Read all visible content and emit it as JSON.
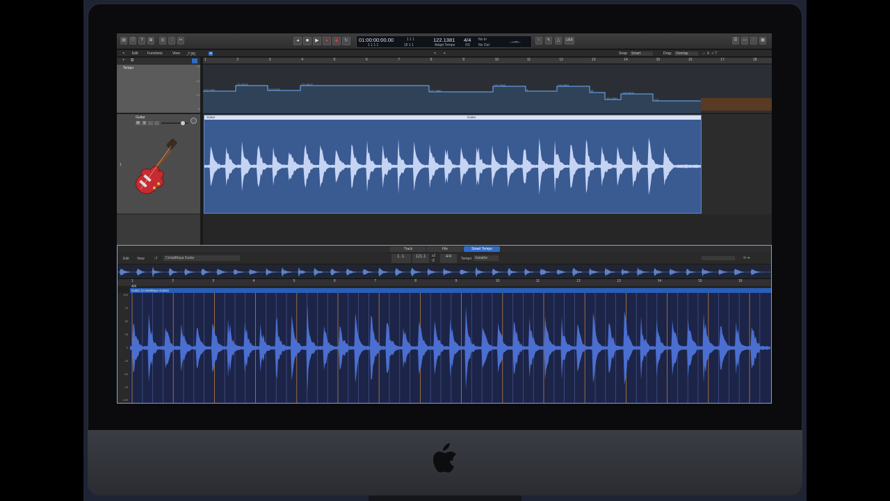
{
  "control_bar": {
    "lcd": {
      "position_time": "01:00:00:00.00",
      "position_bars": "1  1  1     1",
      "end_top": "1  1  1",
      "end_bottom": "16  1  1",
      "tempo": "122.1381",
      "tempo_mode": "Adapt Tempo",
      "signature": "4/4",
      "division": "/16",
      "midi_in": "No In",
      "midi_out": "No Out"
    },
    "cpu_badge": "c64"
  },
  "tracks_menubar": {
    "edit": "Edit",
    "functions": "Functions",
    "view": "View",
    "snap_label": "Snap:",
    "snap_value": "Smart",
    "drag_label": "Drag:",
    "drag_value": "Overlap"
  },
  "ruler_bars": [
    "1",
    "2",
    "3",
    "4",
    "5",
    "6",
    "7",
    "8",
    "9",
    "10",
    "11",
    "12",
    "13",
    "14",
    "15",
    "16",
    "17",
    "18"
  ],
  "tempo_track": {
    "name": "Tempo",
    "scale": [
      "130",
      "120",
      "110",
      "90"
    ],
    "values": [
      "122.1381",
      "120.8978",
      "123.5230",
      "121.8632",
      "121.7680",
      "120.1508",
      "5",
      "120.4081",
      "15",
      "111.3281",
      "109.9478",
      "110"
    ]
  },
  "guitar_track": {
    "number": "1",
    "name": "Guitar",
    "mute": "M",
    "solo": "S",
    "region_label_1": "Guitar",
    "region_label_2": "Guitar"
  },
  "editor": {
    "tabs": [
      "Track",
      "File",
      "Smart Tempo"
    ],
    "active_tab": "Smart Tempo",
    "edit": "Edit",
    "view": "View",
    "file_name": "CristalMaya Guitar",
    "position": "1. 1.",
    "tempo": "121.1",
    "x2": "x2",
    "half": "/2",
    "signature": "4/4",
    "tempo_label": "Tempo:",
    "tempo_mode": "Variable",
    "signature_marker": "4/4",
    "region_name": "Guitar (CristalMaya Guitar)",
    "ruler_bars": [
      "1",
      "2",
      "3",
      "4",
      "5",
      "6",
      "7",
      "8",
      "9",
      "10",
      "11",
      "12",
      "13",
      "14",
      "15",
      "16"
    ],
    "y_scale": [
      "100",
      "75",
      "50",
      "25",
      "0",
      "-25",
      "-50",
      "-75",
      "-100"
    ]
  },
  "colors": {
    "region_blue": "#3a5a92",
    "waveform": "#c6d4f4",
    "editor_wave": "#4a6fd0",
    "beat_marker": "#d28c3c",
    "tempo_accent": "#6fb3ff",
    "guitar_red": "#c52b2f"
  }
}
